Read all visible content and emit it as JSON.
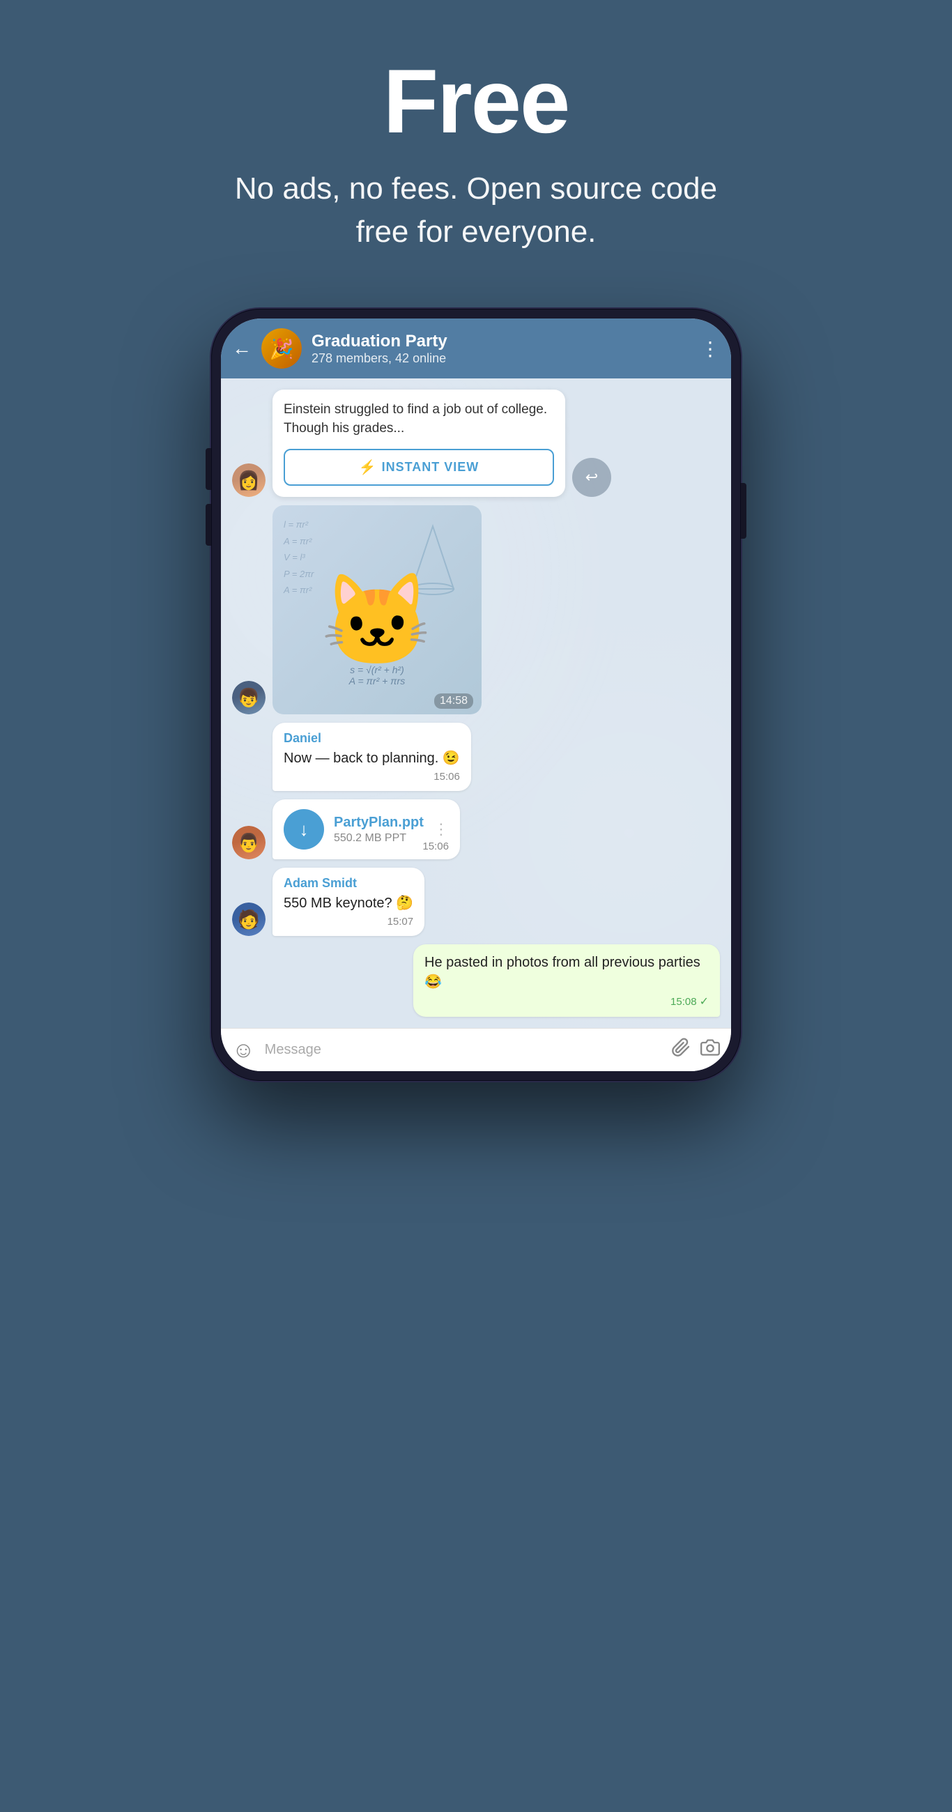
{
  "hero": {
    "title": "Free",
    "subtitle": "No ads, no fees. Open source code free for everyone."
  },
  "phone": {
    "header": {
      "back_label": "←",
      "group_name": "Graduation Party",
      "group_meta": "278 members, 42 online",
      "menu_icon": "⋮"
    },
    "messages": [
      {
        "id": "article-msg",
        "type": "article",
        "sender_avatar": "girl",
        "article_text": "Einstein struggled to find a job out of college. Though his grades...",
        "instant_view_label": "INSTANT VIEW"
      },
      {
        "id": "sticker-msg",
        "type": "sticker",
        "sender_avatar": "boy1",
        "time": "14:58"
      },
      {
        "id": "daniel-msg",
        "type": "text",
        "sender": "Daniel",
        "sender_avatar": null,
        "text": "Now — back to planning. 😉",
        "time": "15:06"
      },
      {
        "id": "file-msg",
        "type": "file",
        "sender_avatar": "boy2",
        "file_name": "PartyPlan.ppt",
        "file_size": "550.2 MB PPT",
        "time": "15:06"
      },
      {
        "id": "adam-msg",
        "type": "text",
        "sender": "Adam Smidt",
        "sender_avatar": "boy3",
        "text": "550 MB keynote? 🤔",
        "time": "15:07"
      },
      {
        "id": "outgoing-msg",
        "type": "text_outgoing",
        "text": "He pasted in photos from all previous parties 😂",
        "time": "15:08",
        "read": true
      }
    ],
    "input_bar": {
      "placeholder": "Message",
      "emoji_icon": "☺",
      "attach_icon": "📎",
      "camera_icon": "⊙"
    }
  }
}
